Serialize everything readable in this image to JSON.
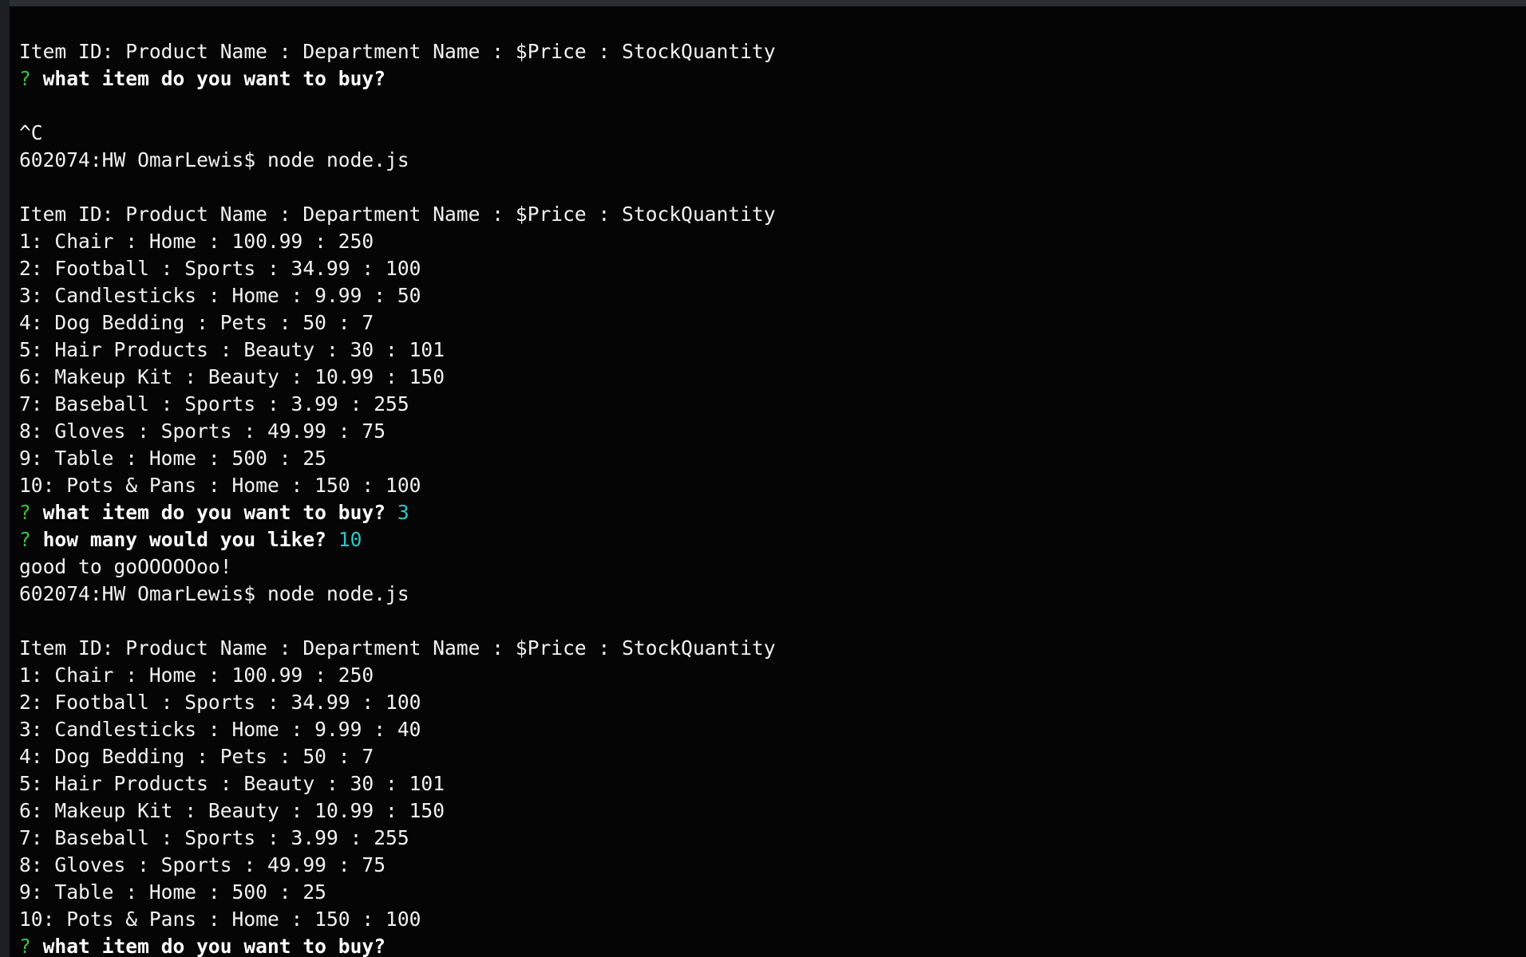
{
  "terminal": {
    "lines": [
      {
        "type": "text",
        "text": "Item ID: Product Name : Department Name : $Price : StockQuantity"
      },
      {
        "type": "question",
        "mark": "?",
        "q": "what item do you want to buy?",
        "a": ""
      },
      {
        "type": "text",
        "text": ""
      },
      {
        "type": "text",
        "text": "^C"
      },
      {
        "type": "text",
        "text": "602074:HW OmarLewis$ node node.js"
      },
      {
        "type": "text",
        "text": ""
      },
      {
        "type": "text",
        "text": "Item ID: Product Name : Department Name : $Price : StockQuantity"
      },
      {
        "type": "text",
        "text": "1: Chair : Home : 100.99 : 250"
      },
      {
        "type": "text",
        "text": "2: Football : Sports : 34.99 : 100"
      },
      {
        "type": "text",
        "text": "3: Candlesticks : Home : 9.99 : 50"
      },
      {
        "type": "text",
        "text": "4: Dog Bedding : Pets : 50 : 7"
      },
      {
        "type": "text",
        "text": "5: Hair Products : Beauty : 30 : 101"
      },
      {
        "type": "text",
        "text": "6: Makeup Kit : Beauty : 10.99 : 150"
      },
      {
        "type": "text",
        "text": "7: Baseball : Sports : 3.99 : 255"
      },
      {
        "type": "text",
        "text": "8: Gloves : Sports : 49.99 : 75"
      },
      {
        "type": "text",
        "text": "9: Table : Home : 500 : 25"
      },
      {
        "type": "text",
        "text": "10: Pots & Pans : Home : 150 : 100"
      },
      {
        "type": "question",
        "mark": "?",
        "q": "what item do you want to buy?",
        "a": "3"
      },
      {
        "type": "question",
        "mark": "?",
        "q": "how many would you like?",
        "a": "10"
      },
      {
        "type": "text",
        "text": "good to goOOOOOoo!"
      },
      {
        "type": "text",
        "text": "602074:HW OmarLewis$ node node.js"
      },
      {
        "type": "text",
        "text": ""
      },
      {
        "type": "text",
        "text": "Item ID: Product Name : Department Name : $Price : StockQuantity"
      },
      {
        "type": "text",
        "text": "1: Chair : Home : 100.99 : 250"
      },
      {
        "type": "text",
        "text": "2: Football : Sports : 34.99 : 100"
      },
      {
        "type": "text",
        "text": "3: Candlesticks : Home : 9.99 : 40"
      },
      {
        "type": "text",
        "text": "4: Dog Bedding : Pets : 50 : 7"
      },
      {
        "type": "text",
        "text": "5: Hair Products : Beauty : 30 : 101"
      },
      {
        "type": "text",
        "text": "6: Makeup Kit : Beauty : 10.99 : 150"
      },
      {
        "type": "text",
        "text": "7: Baseball : Sports : 3.99 : 255"
      },
      {
        "type": "text",
        "text": "8: Gloves : Sports : 49.99 : 75"
      },
      {
        "type": "text",
        "text": "9: Table : Home : 500 : 25"
      },
      {
        "type": "text",
        "text": "10: Pots & Pans : Home : 150 : 100"
      },
      {
        "type": "question",
        "mark": "?",
        "q": "what item do you want to buy?",
        "a": ""
      }
    ]
  },
  "colors": {
    "background": "#050505",
    "text": "#f2f2f2",
    "prompt_mark": "#3ec23e",
    "answer": "#2cc6c6"
  }
}
